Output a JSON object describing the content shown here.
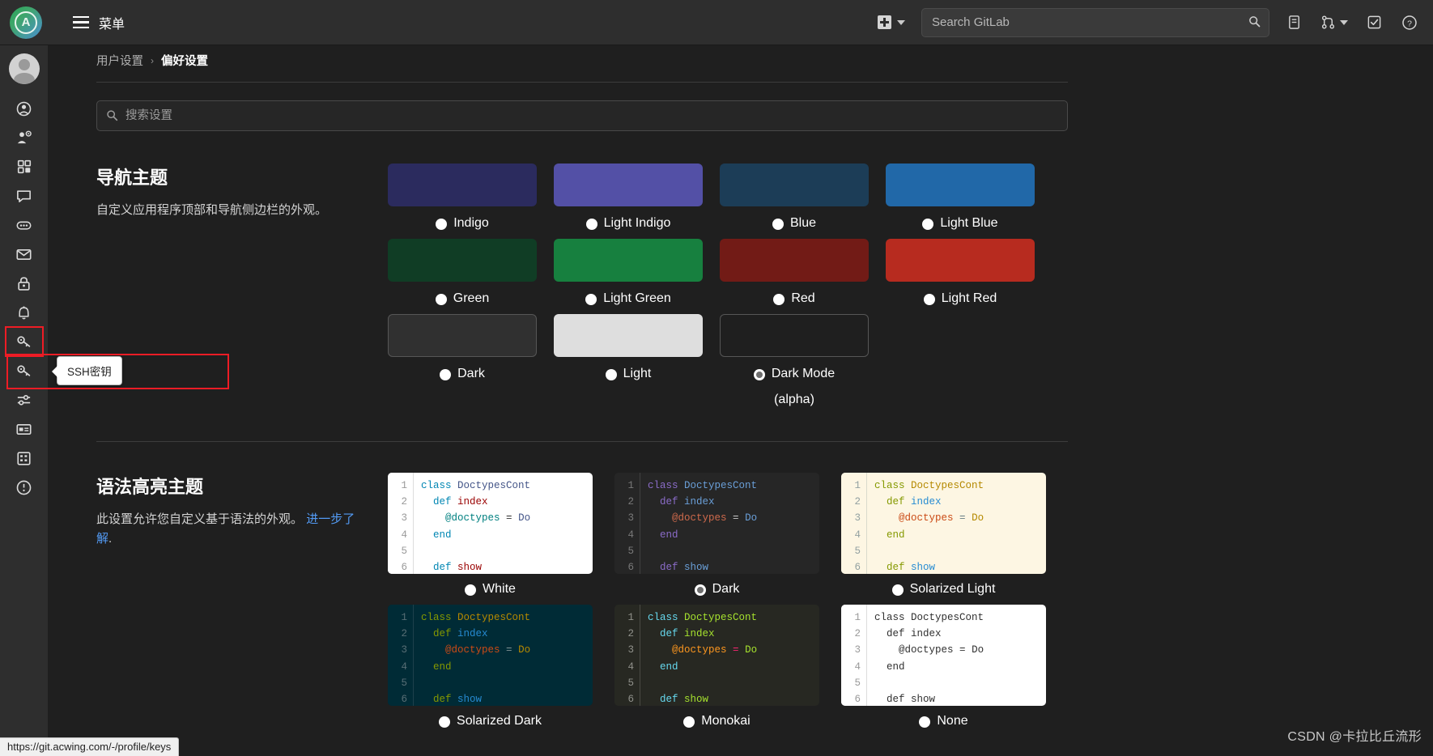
{
  "topbar": {
    "menu_label": "菜单",
    "logo_letter": "A",
    "create_icon": "plus-square-icon",
    "search_placeholder": "Search GitLab",
    "search_value": "",
    "icons": [
      {
        "name": "issues-icon",
        "glyph": "▤"
      },
      {
        "name": "merge-requests-icon",
        "glyph": "⎇"
      },
      {
        "name": "todos-icon",
        "glyph": "☑"
      },
      {
        "name": "help-icon",
        "glyph": "?"
      }
    ]
  },
  "sidebar": {
    "avatar_name": "user-avatar",
    "items": [
      {
        "name": "sidebar-item-profile",
        "icon": "user-circle-icon"
      },
      {
        "name": "sidebar-item-account",
        "icon": "user-gear-icon"
      },
      {
        "name": "sidebar-item-applications",
        "icon": "grid-apps-icon"
      },
      {
        "name": "sidebar-item-chat",
        "icon": "chat-bubble-icon"
      },
      {
        "name": "sidebar-item-access-tokens",
        "icon": "comment-dots-icon"
      },
      {
        "name": "sidebar-item-emails",
        "icon": "envelope-icon"
      },
      {
        "name": "sidebar-item-password",
        "icon": "lock-icon"
      },
      {
        "name": "sidebar-item-notifications",
        "icon": "bell-icon"
      },
      {
        "name": "sidebar-item-ssh-keys",
        "icon": "key-icon"
      },
      {
        "name": "sidebar-item-gpg-keys",
        "icon": "key-icon"
      },
      {
        "name": "sidebar-item-preferences",
        "icon": "sliders-icon"
      },
      {
        "name": "sidebar-item-active-sessions",
        "icon": "monitor-icon"
      },
      {
        "name": "sidebar-item-authentication-log",
        "icon": "table-log-icon"
      },
      {
        "name": "sidebar-item-usage-quotas",
        "icon": "info-circle-icon"
      }
    ],
    "tooltip": "SSH密钥"
  },
  "breadcrumb": {
    "parent": "用户设置",
    "separator": "›",
    "current": "偏好设置"
  },
  "settings_search": {
    "placeholder": "搜索设置",
    "value": ""
  },
  "nav_theme": {
    "title": "导航主题",
    "description": "自定义应用程序顶部和导航侧边栏的外观。",
    "options": [
      {
        "label": "Indigo",
        "color": "#2b2b5e",
        "selected": false,
        "bordered": false
      },
      {
        "label": "Light Indigo",
        "color": "#5350a6",
        "selected": false,
        "bordered": false
      },
      {
        "label": "Blue",
        "color": "#1c3d57",
        "selected": false,
        "bordered": false
      },
      {
        "label": "Light Blue",
        "color": "#2168a8",
        "selected": false,
        "bordered": false
      },
      {
        "label": "Green",
        "color": "#103d25",
        "selected": false,
        "bordered": false
      },
      {
        "label": "Light Green",
        "color": "#17803f",
        "selected": false,
        "bordered": false
      },
      {
        "label": "Red",
        "color": "#721b16",
        "selected": false,
        "bordered": false
      },
      {
        "label": "Light Red",
        "color": "#b72b1f",
        "selected": false,
        "bordered": false
      },
      {
        "label": "Dark",
        "color": "#303030",
        "selected": false,
        "bordered": true
      },
      {
        "label": "Light",
        "color": "#dedede",
        "selected": false,
        "bordered": false
      },
      {
        "label": "Dark Mode",
        "label2": "(alpha)",
        "color": "#1f1f1f",
        "selected": true,
        "bordered": true
      }
    ]
  },
  "syntax_theme": {
    "title": "语法高亮主题",
    "description_text": "此设置允许您自定义基于语法的外观。",
    "description_link": "进一步了解",
    "description_tail": ".",
    "line_numbers": [
      "1",
      "2",
      "3",
      "4",
      "5",
      "6"
    ],
    "code_lines": [
      "class DoctypesCont",
      "  def index",
      "    @doctypes = Do",
      "  end",
      "",
      "  def show"
    ],
    "options": [
      {
        "label": "White",
        "selected": false,
        "bg": "#ffffff",
        "fg": "#303030",
        "gutter_bg": "#ffffff",
        "gutter_fg": "#9a9a9a",
        "kw": "#0086b3",
        "cls": "#445588",
        "fn": "#990000",
        "ivar": "#008080",
        "op": "#303030"
      },
      {
        "label": "Dark",
        "selected": true,
        "bg": "#262626",
        "fg": "#c9c9c9",
        "gutter_bg": "#262626",
        "gutter_fg": "#797979",
        "kw": "#8b6cc9",
        "cls": "#6a9fd8",
        "fn": "#6a9fd8",
        "ivar": "#cf6a4c",
        "op": "#c9c9c9"
      },
      {
        "label": "Solarized Light",
        "selected": false,
        "bg": "#fdf6e3",
        "fg": "#657b83",
        "gutter_bg": "#fdf6e3",
        "gutter_fg": "#93a1a1",
        "kw": "#859900",
        "cls": "#b58900",
        "fn": "#268bd2",
        "ivar": "#cb4b16",
        "op": "#657b83"
      },
      {
        "label": "Solarized Dark",
        "selected": false,
        "bg": "#002b36",
        "fg": "#839496",
        "gutter_bg": "#002b36",
        "gutter_fg": "#586e75",
        "kw": "#859900",
        "cls": "#b58900",
        "fn": "#268bd2",
        "ivar": "#cb4b16",
        "op": "#839496"
      },
      {
        "label": "Monokai",
        "selected": false,
        "bg": "#272822",
        "fg": "#f8f8f2",
        "gutter_bg": "#272822",
        "gutter_fg": "#8f908a",
        "kw": "#66d9ef",
        "cls": "#a6e22e",
        "fn": "#a6e22e",
        "ivar": "#fd971f",
        "op": "#f92672"
      },
      {
        "label": "None",
        "selected": false,
        "bg": "#ffffff",
        "fg": "#303030",
        "gutter_bg": "#ffffff",
        "gutter_fg": "#9a9a9a",
        "kw": "#303030",
        "cls": "#303030",
        "fn": "#303030",
        "ivar": "#303030",
        "op": "#303030"
      }
    ]
  },
  "statusbar": {
    "url": "https://git.acwing.com/-/profile/keys"
  },
  "watermark": {
    "text": "CSDN @卡拉比丘流形"
  }
}
